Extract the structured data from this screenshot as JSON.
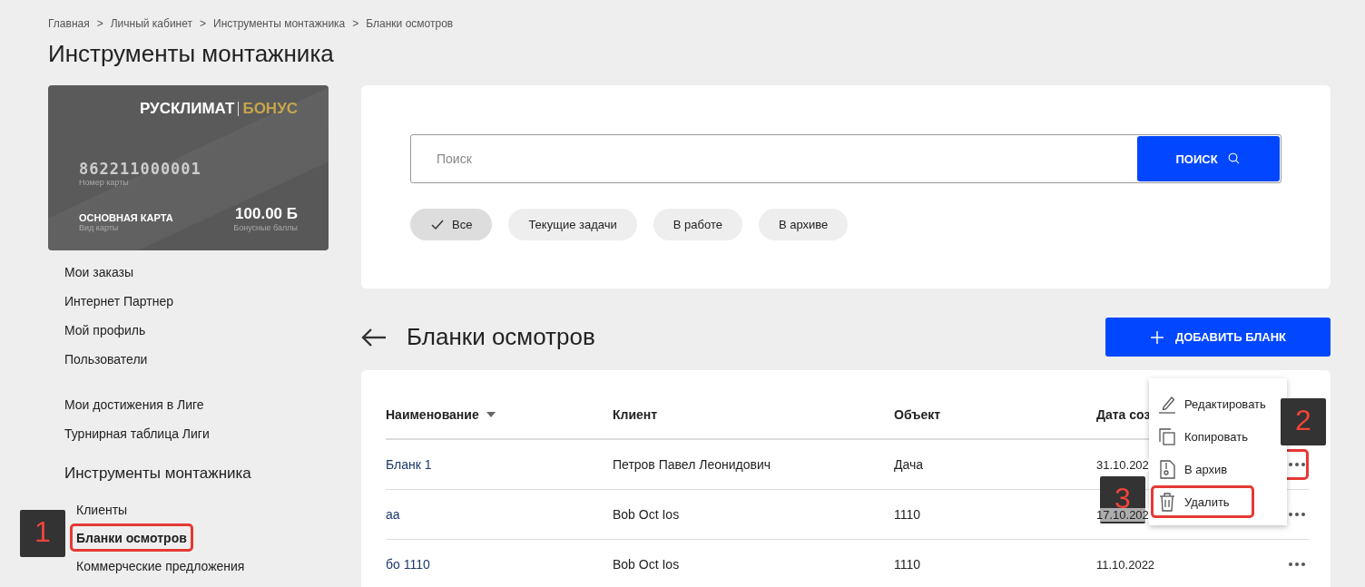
{
  "breadcrumbs": [
    "Главная",
    "Личный кабинет",
    "Инструменты монтажника",
    "Бланки осмотров"
  ],
  "breadcrumb_separator": ">",
  "page_title": "Инструменты монтажника",
  "bonus_card": {
    "brand": "РУСКЛИМАТ",
    "brand_suffix": "БОНУС",
    "number": "862211000001",
    "number_label": "Номер карты",
    "type": "ОСНОВНАЯ КАРТА",
    "type_label": "Вид карты",
    "points": "100.00 Б",
    "points_label": "Бонусные баллы"
  },
  "sidebar": {
    "groups": [
      {
        "items": [
          {
            "label": "Мои заказы"
          },
          {
            "label": "Интернет Партнер"
          },
          {
            "label": "Мой профиль"
          },
          {
            "label": "Пользователи"
          }
        ]
      },
      {
        "items": [
          {
            "label": "Мои достижения в Лиге"
          },
          {
            "label": "Турнирная таблица Лиги"
          }
        ]
      }
    ],
    "section": {
      "title": "Инструменты монтажника",
      "items": [
        {
          "label": "Клиенты",
          "selected": false,
          "highlighted": false
        },
        {
          "label": "Бланки осмотров",
          "selected": true,
          "highlighted": true
        },
        {
          "label": "Коммерческие предложения",
          "selected": false,
          "highlighted": false
        }
      ]
    }
  },
  "search": {
    "placeholder": "Поиск",
    "button": "ПОИСК"
  },
  "filters": [
    {
      "label": "Все",
      "selected": true
    },
    {
      "label": "Текущие задачи",
      "selected": false
    },
    {
      "label": "В работе",
      "selected": false
    },
    {
      "label": "В архиве",
      "selected": false
    }
  ],
  "list_title": "Бланки осмотров",
  "add_button": "ДОБАВИТЬ БЛАНК",
  "table": {
    "columns": [
      {
        "label": "Наименование",
        "sorted": true
      },
      {
        "label": "Клиент",
        "sorted": false
      },
      {
        "label": "Объект",
        "sorted": false
      },
      {
        "label": "Дата соз",
        "sorted": false
      }
    ],
    "rows": [
      {
        "cells": [
          "Бланк 1",
          "Петров Павел Леонидович",
          "Дача",
          "31.10.202"
        ],
        "menu_highlighted": true
      },
      {
        "cells": [
          "аа",
          "Bob Oct Ios",
          "1110",
          "17.10.202"
        ],
        "menu_highlighted": false
      },
      {
        "cells": [
          "бо 1110",
          "Bob Oct Ios",
          "1110",
          "11.10.2022"
        ],
        "menu_highlighted": false
      }
    ]
  },
  "row_menu": {
    "items": [
      {
        "kind": "edit",
        "label": "Редактировать",
        "highlighted": false
      },
      {
        "kind": "copy",
        "label": "Копировать",
        "highlighted": false
      },
      {
        "kind": "archive",
        "label": "В архив",
        "highlighted": false
      },
      {
        "kind": "delete",
        "label": "Удалить",
        "highlighted": true
      }
    ]
  },
  "annotations": [
    {
      "label": "1"
    },
    {
      "label": "2"
    },
    {
      "label": "3"
    }
  ]
}
